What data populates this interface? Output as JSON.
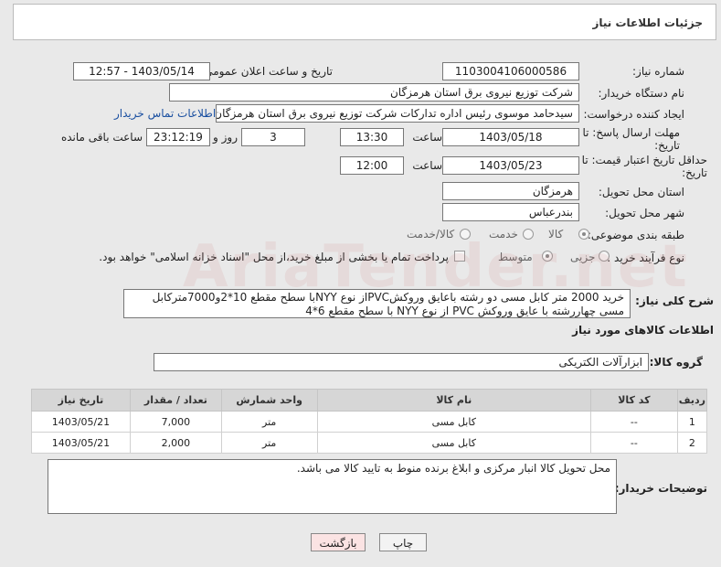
{
  "header": {
    "title": "جزئیات اطلاعات نیاز"
  },
  "fields": {
    "need_number_label": "شماره نیاز:",
    "need_number": "1103004106000586",
    "announce_label": "تاریخ و ساعت اعلان عمومی:",
    "announce_value": "1403/05/14 - 12:57",
    "buyer_org_label": "نام دستگاه خریدار:",
    "buyer_org": "شرکت توزیع نیروی برق استان هرمزگان",
    "creator_label": "ایجاد کننده درخواست:",
    "creator": "سیدحامد موسوی رئیس اداره تدارکات شرکت توزیع نیروی برق استان هرمزگان",
    "contact_link": "اطلاعات تماس خریدار",
    "deadline_label": "مهلت ارسال پاسخ: تا تاریخ:",
    "deadline_date": "1403/05/18",
    "time_label": "ساعت",
    "deadline_time": "13:30",
    "days_value": "3",
    "days_label": "روز و",
    "remaining_time": "23:12:19",
    "remaining_label": "ساعت باقی مانده",
    "validity_label": "حداقل تاریخ اعتبار قیمت: تا تاریخ:",
    "validity_date": "1403/05/23",
    "validity_time": "12:00",
    "province_label": "استان محل تحویل:",
    "province": "هرمزگان",
    "city_label": "شهر محل تحویل:",
    "city": "بندرعباس",
    "category_label": "طبقه بندی موضوعی:",
    "category_options": [
      "کالا",
      "خدمت",
      "کالا/خدمت"
    ],
    "process_label": "نوع فرآیند خرید :",
    "process_options": [
      "جزیی",
      "متوسط"
    ],
    "payment_note": "پرداخت تمام یا بخشی از مبلغ خرید،از محل \"اسناد خزانه اسلامی\" خواهد بود."
  },
  "description": {
    "label": "شرح کلی نیاز:",
    "text": "خرید 2000 متر کابل مسی دو رشته باعایق وروکشPVCاز نوع NYYبا سطح مقطع 10*2و7000مترکابل مسی چهاررشته با عایق وروکش PVC از نوع NYY با سطح مقطع 6*4"
  },
  "goods_section": "اطلاعات کالاهای مورد نیاز",
  "goods_group": {
    "label": "گروه کالا:",
    "value": "ابزارآلات الکتریکی"
  },
  "table": {
    "headers": [
      "ردیف",
      "کد کالا",
      "نام کالا",
      "واحد شمارش",
      "تعداد / مقدار",
      "تاریخ نیاز"
    ],
    "rows": [
      [
        "1",
        "--",
        "کابل مسی",
        "متر",
        "7,000",
        "1403/05/21"
      ],
      [
        "2",
        "--",
        "کابل مسی",
        "متر",
        "2,000",
        "1403/05/21"
      ]
    ]
  },
  "notes": {
    "label": "توضیحات خریدار:",
    "text": "محل تحویل کالا انبار مرکزی و  ابلاغ برنده منوط به تایید کالا می باشد."
  },
  "buttons": {
    "print": "چاپ",
    "back": "بازگشت"
  },
  "colors": {
    "accent_link": "#1a4fa0",
    "back_button_bg": "#fbe3e3"
  }
}
